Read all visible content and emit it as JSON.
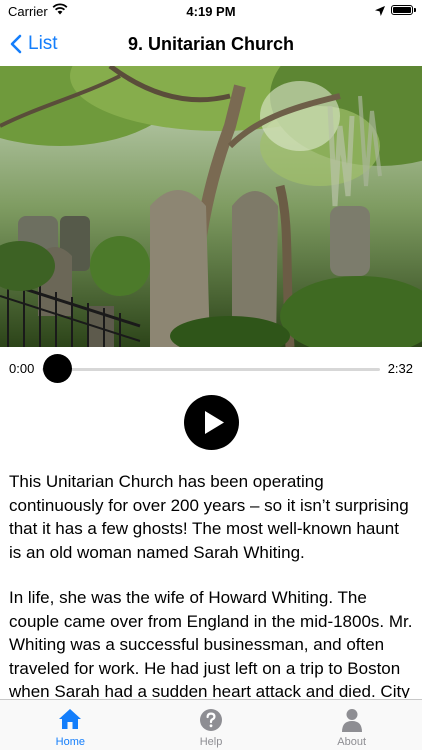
{
  "status_bar": {
    "carrier": "Carrier",
    "time": "4:19 PM"
  },
  "nav": {
    "back_label": "List",
    "title": "9. Unitarian Church"
  },
  "player": {
    "elapsed": "0:00",
    "duration": "2:32",
    "progress": 0.0
  },
  "content": {
    "paragraphs": [
      "This Unitarian Church has been operating continuously for over 200 years – so it isn’t surprising that it has a few ghosts! The most well-known haunt is an old woman named Sarah Whiting.",
      "In life, she was the wife of Howard Whiting. The couple came over from England in the mid-1800s. Mr. Whiting was a successful businessman, and often traveled for work. He had just left on a trip to Boston when Sarah had a sudden heart attack and died. City officials sent Howard a telegram, and a"
    ]
  },
  "tabs": [
    {
      "label": "Home",
      "icon": "home-icon",
      "active": true
    },
    {
      "label": "Help",
      "icon": "help-icon",
      "active": false
    },
    {
      "label": "About",
      "icon": "person-icon",
      "active": false
    }
  ],
  "colors": {
    "accent": "#147efb",
    "inactive": "#8e8e93"
  }
}
